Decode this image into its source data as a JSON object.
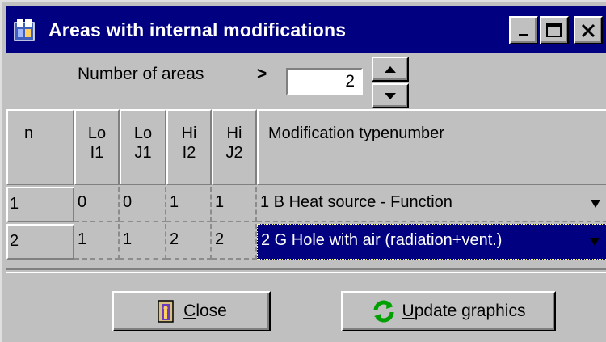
{
  "window": {
    "title": "Areas with internal modifications",
    "controls": {
      "minimize": "_",
      "maximize": "□",
      "close": "×"
    }
  },
  "count": {
    "label": "Number of areas",
    "arrow": ">",
    "value": "2"
  },
  "table": {
    "headers": [
      {
        "line1": "n",
        "line2": ""
      },
      {
        "line1": "Lo",
        "line2": "I1"
      },
      {
        "line1": "Lo",
        "line2": "J1"
      },
      {
        "line1": "Hi",
        "line2": "I2"
      },
      {
        "line1": "Hi",
        "line2": "J2"
      },
      {
        "line1": "Modification typenumber",
        "line2": ""
      }
    ],
    "rows": [
      {
        "n": "1",
        "lo_i1": "0",
        "lo_j1": "0",
        "hi_i2": "1",
        "hi_j2": "1",
        "type": "1 B Heat source - Function"
      },
      {
        "n": "2",
        "lo_i1": "1",
        "lo_j1": "1",
        "hi_i2": "2",
        "hi_j2": "2",
        "type": "2 G Hole with air (radiation+vent.)"
      }
    ]
  },
  "buttons": {
    "close_underlined": "C",
    "close_rest": "lose",
    "update_underlined": "U",
    "update_rest": "pdate graphics"
  },
  "colors": {
    "titlebar": "#000080",
    "face": "#c0c0c0",
    "selection": "#000080"
  }
}
